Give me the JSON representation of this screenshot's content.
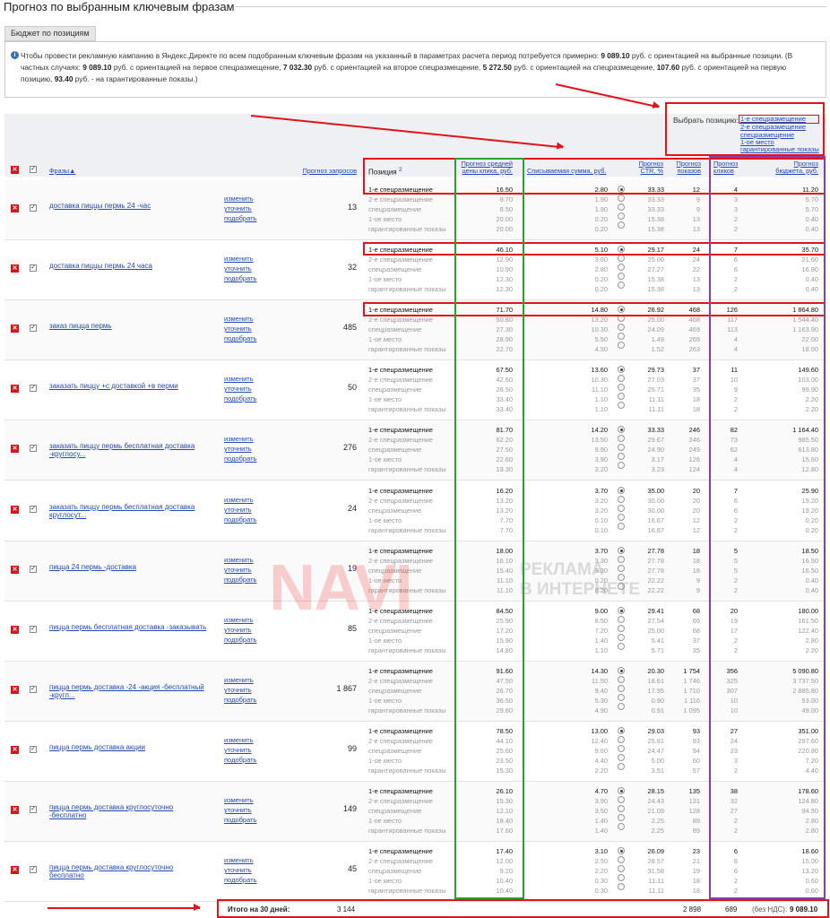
{
  "title": "Прогноз по выбранным ключевым фразам",
  "tab": "Бюджет по позициям",
  "info": {
    "text1": "Чтобы провести рекламную кампанию в Яндекс.Директе по всем подобранным ключевым фразам на указанный в параметрах расчета период потребуется примерно: ",
    "b1": "9 089.10",
    "text2": " руб. с ориентацией на выбранные позиции. (В частных случаях: ",
    "b2": "9 089.10",
    "text3": " руб. с ориентацией на первое спецразмещение, ",
    "b3": "7 032.30",
    "text4": " руб. с ориентацией на второе спецразмещение, ",
    "b4": "5 272.50",
    "text5": " руб. с ориентацией на спецразмещение, ",
    "b5": "107.60",
    "text6": " руб. с ориентацией на первую позицию, ",
    "b6": "93.40",
    "text7": " руб. - на гарантированные показы.)"
  },
  "select": {
    "label": "Выбрать позицию:",
    "options": [
      "1-е спецразмещение",
      "2-е спецразмещение",
      "спецразмещение",
      "1-ое место",
      "гарантированные показы"
    ]
  },
  "headers": {
    "phrases": "Фразы▲",
    "requests": "Прогноз запросов",
    "position": "Позиция",
    "position_sup": "2",
    "cpc_l1": "Прогноз средней",
    "cpc_l2": "цены клика, руб.",
    "spend": "Списываемая сумма, руб.",
    "ctr_l1": "Прогноз",
    "ctr_l2": "CTR, %",
    "shows_l1": "Прогноз",
    "shows_l2": "показов",
    "clicks_l1": "Прогноз",
    "clicks_l2": "кликов",
    "budget_l1": "Прогноз",
    "budget_l2": "бюджета, руб."
  },
  "actions": [
    "изменить",
    "уточнить",
    "подобрать"
  ],
  "positions": [
    "1-е спецразмещение",
    "2-е спецразмещение",
    "спецразмещение",
    "1-ое место",
    "гарантированные показы"
  ],
  "rows": [
    {
      "phrase": "доставка пиццы пермь 24 -час",
      "requests": "13",
      "cpc": [
        "16.50",
        "8.70",
        "8.50",
        "20.00",
        "20.00"
      ],
      "spend": [
        "2.80",
        "1.90",
        "1.90",
        "0.20",
        "0.20"
      ],
      "ctr": [
        "33.33",
        "33.33",
        "33.33",
        "15.38",
        "15.38"
      ],
      "shows": [
        "12",
        "9",
        "9",
        "13",
        "13"
      ],
      "clicks": [
        "4",
        "3",
        "3",
        "2",
        "2"
      ],
      "budget": [
        "11.20",
        "5.70",
        "5.70",
        "0.40",
        "0.40"
      ]
    },
    {
      "phrase": "доставка пиццы пермь 24 часа",
      "requests": "32",
      "cpc": [
        "46.10",
        "12.90",
        "10.90",
        "12.30",
        "12.30"
      ],
      "spend": [
        "5.10",
        "3.60",
        "2.80",
        "0.20",
        "0.20"
      ],
      "ctr": [
        "29.17",
        "25.00",
        "27.27",
        "15.38",
        "15.38"
      ],
      "shows": [
        "24",
        "24",
        "22",
        "13",
        "13"
      ],
      "clicks": [
        "7",
        "6",
        "6",
        "2",
        "2"
      ],
      "budget": [
        "35.70",
        "21.60",
        "16.80",
        "0.40",
        "0.40"
      ]
    },
    {
      "phrase": "заказ пицца пермь",
      "requests": "485",
      "cpc": [
        "71.70",
        "50.80",
        "27.30",
        "28.90",
        "22.70"
      ],
      "spend": [
        "14.80",
        "13.20",
        "10.30",
        "5.50",
        "4.50"
      ],
      "ctr": [
        "26.92",
        "25.00",
        "24.09",
        "1.49",
        "1.52"
      ],
      "shows": [
        "468",
        "468",
        "469",
        "269",
        "263"
      ],
      "clicks": [
        "126",
        "117",
        "113",
        "4",
        "4"
      ],
      "budget": [
        "1 864.80",
        "1 544.40",
        "1 163.90",
        "22.00",
        "18.00"
      ]
    },
    {
      "phrase": "заказать пиццу +с доставкой +в перми",
      "requests": "50",
      "cpc": [
        "67.50",
        "42.60",
        "26.50",
        "33.40",
        "33.40"
      ],
      "spend": [
        "13.60",
        "10.30",
        "11.10",
        "1.10",
        "1.10"
      ],
      "ctr": [
        "29.73",
        "27.03",
        "25.71",
        "11.11",
        "11.11"
      ],
      "shows": [
        "37",
        "37",
        "35",
        "18",
        "18"
      ],
      "clicks": [
        "11",
        "10",
        "9",
        "2",
        "2"
      ],
      "budget": [
        "149.60",
        "103.00",
        "99.90",
        "2.20",
        "2.20"
      ]
    },
    {
      "phrase": "заказать пиццу пермь бесплатная доставка -круглосу...",
      "requests": "276",
      "cpc": [
        "81.70",
        "62.20",
        "27.50",
        "22.60",
        "19.30"
      ],
      "spend": [
        "14.20",
        "13.50",
        "9.90",
        "3.90",
        "3.20"
      ],
      "ctr": [
        "33.33",
        "29.67",
        "24.90",
        "3.17",
        "3.23"
      ],
      "shows": [
        "246",
        "246",
        "249",
        "126",
        "124"
      ],
      "clicks": [
        "82",
        "73",
        "62",
        "4",
        "4"
      ],
      "budget": [
        "1 164.40",
        "985.50",
        "613.80",
        "15.60",
        "12.80"
      ]
    },
    {
      "phrase": "заказать пиццу пермь бесплатная доставка круглосут...",
      "requests": "24",
      "cpc": [
        "16.20",
        "13.20",
        "13.20",
        "7.70",
        "7.70"
      ],
      "spend": [
        "3.70",
        "3.20",
        "3.20",
        "0.10",
        "0.10"
      ],
      "ctr": [
        "35.00",
        "30.00",
        "30.00",
        "16.67",
        "16.67"
      ],
      "shows": [
        "20",
        "20",
        "20",
        "12",
        "12"
      ],
      "clicks": [
        "7",
        "6",
        "6",
        "2",
        "2"
      ],
      "budget": [
        "25.90",
        "19.20",
        "19.20",
        "0.20",
        "0.20"
      ]
    },
    {
      "phrase": "пицца 24 пермь -доставка",
      "requests": "19",
      "cpc": [
        "18.00",
        "16.10",
        "15.40",
        "11.10",
        "11.10"
      ],
      "spend": [
        "3.70",
        "3.30",
        "3.30",
        "0.20",
        "0.20"
      ],
      "ctr": [
        "27.78",
        "27.78",
        "27.78",
        "22.22",
        "22.22"
      ],
      "shows": [
        "18",
        "18",
        "18",
        "9",
        "9"
      ],
      "clicks": [
        "5",
        "5",
        "5",
        "2",
        "2"
      ],
      "budget": [
        "18.50",
        "16.50",
        "16.50",
        "0.40",
        "0.40"
      ]
    },
    {
      "phrase": "пицца пермь бесплатная доставка -заказывать",
      "requests": "85",
      "cpc": [
        "84.50",
        "25.90",
        "17.20",
        "15.90",
        "14.80"
      ],
      "spend": [
        "9.00",
        "8.50",
        "7.20",
        "1.40",
        "1.10"
      ],
      "ctr": [
        "29.41",
        "27.54",
        "25.00",
        "5.41",
        "5.71"
      ],
      "shows": [
        "68",
        "69",
        "68",
        "37",
        "35"
      ],
      "clicks": [
        "20",
        "19",
        "17",
        "2",
        "2"
      ],
      "budget": [
        "180.00",
        "161.50",
        "122.40",
        "2.80",
        "2.20"
      ]
    },
    {
      "phrase": "пицца пермь доставка -24 -акция -бесплатный -кругл...",
      "requests": "1 867",
      "cpc": [
        "91.60",
        "47.50",
        "26.70",
        "36.50",
        "29.60"
      ],
      "spend": [
        "14.30",
        "11.50",
        "9.40",
        "5.30",
        "4.90"
      ],
      "ctr": [
        "20.30",
        "18.61",
        "17.95",
        "0.90",
        "0.91"
      ],
      "shows": [
        "1 754",
        "1 746",
        "1 710",
        "1 116",
        "1 095"
      ],
      "clicks": [
        "356",
        "325",
        "307",
        "10",
        "10"
      ],
      "budget": [
        "5 090.80",
        "3 737.50",
        "2 885.80",
        "53.00",
        "49.00"
      ]
    },
    {
      "phrase": "пицца пермь доставка акции",
      "requests": "99",
      "cpc": [
        "78.50",
        "44.10",
        "25.60",
        "23.50",
        "15.30"
      ],
      "spend": [
        "13.00",
        "12.40",
        "9.60",
        "4.40",
        "2.20"
      ],
      "ctr": [
        "29.03",
        "25.81",
        "24.47",
        "5.00",
        "3.51"
      ],
      "shows": [
        "93",
        "93",
        "94",
        "60",
        "57"
      ],
      "clicks": [
        "27",
        "24",
        "23",
        "3",
        "2"
      ],
      "budget": [
        "351.00",
        "297.60",
        "220.80",
        "7.20",
        "4.40"
      ]
    },
    {
      "phrase": "пицца пермь доставка круглосуточно -бесплатно",
      "requests": "149",
      "cpc": [
        "26.10",
        "15.30",
        "12.10",
        "18.40",
        "17.60"
      ],
      "spend": [
        "4.70",
        "3.90",
        "3.50",
        "1.40",
        "1.40"
      ],
      "ctr": [
        "28.15",
        "24.43",
        "21.09",
        "2.25",
        "2.25"
      ],
      "shows": [
        "135",
        "131",
        "128",
        "89",
        "89"
      ],
      "clicks": [
        "38",
        "32",
        "27",
        "2",
        "2"
      ],
      "budget": [
        "178.60",
        "124.80",
        "94.50",
        "2.80",
        "2.80"
      ]
    },
    {
      "phrase": "пицца пермь доставка круглосуточно бесплатно",
      "requests": "45",
      "cpc": [
        "17.40",
        "12.00",
        "9.20",
        "10.40",
        "10.40"
      ],
      "spend": [
        "3.10",
        "2.50",
        "2.20",
        "0.30",
        "0.30"
      ],
      "ctr": [
        "26.09",
        "28.57",
        "31.58",
        "11.11",
        "11.11"
      ],
      "shows": [
        "23",
        "21",
        "19",
        "18",
        "18"
      ],
      "clicks": [
        "6",
        "6",
        "6",
        "2",
        "2"
      ],
      "budget": [
        "18.60",
        "15.00",
        "13.20",
        "0.60",
        "0.60"
      ]
    }
  ],
  "total": {
    "label": "Итого на 30 дней:",
    "requests": "3 144",
    "shows": "2 898",
    "clicks": "689",
    "vat": "(без НДС):",
    "budget": "9 089.10"
  },
  "watermark": {
    "big": "NAVI",
    "l1": "РЕКЛАМА",
    "l2": "В ИНТЕРНЕТЕ"
  },
  "colors": {
    "red": "#e0141b",
    "green": "#2aa32a",
    "purple": "#8a3fa8",
    "link": "#2249b4"
  }
}
